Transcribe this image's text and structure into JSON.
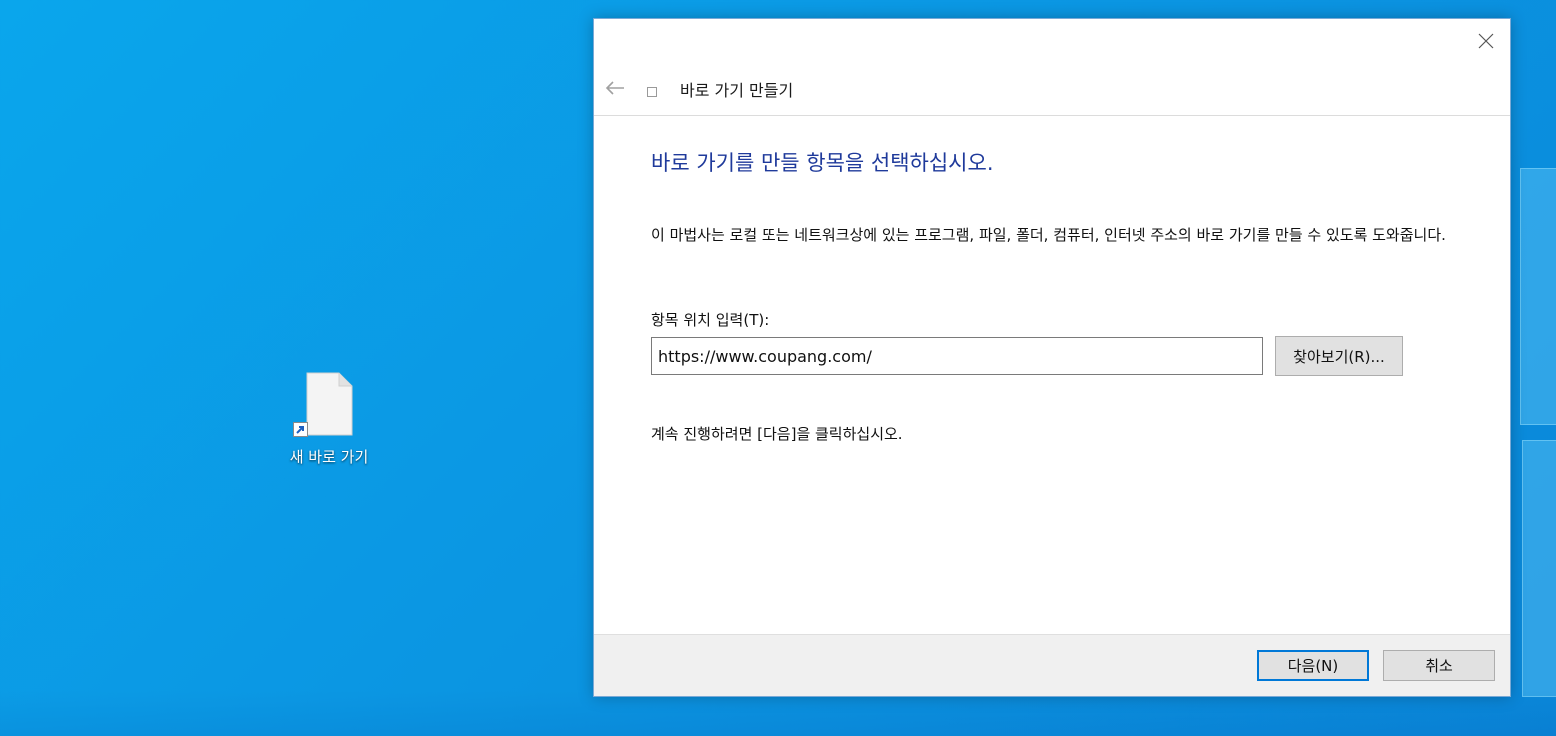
{
  "desktop": {
    "shortcut_label": "새 바로 가기"
  },
  "dialog": {
    "nav_title": "바로 가기 만들기",
    "heading": "바로 가기를 만들 항목을 선택하십시오.",
    "description": "이 마법사는 로컬 또는 네트워크상에 있는 프로그램, 파일, 폴더, 컴퓨터, 인터넷 주소의 바로 가기를 만들 수 있도록 도와줍니다.",
    "field_label": "항목 위치 입력(T):",
    "location_value": "https://www.coupang.com/",
    "browse_label": "찾아보기(R)...",
    "continue_text": "계속 진행하려면 [다음]을 클릭하십시오.",
    "next_label": "다음(N)",
    "cancel_label": "취소"
  },
  "colors": {
    "heading": "#1f3a9b",
    "accent": "#0078d7",
    "desktop": "#0b97e3"
  }
}
